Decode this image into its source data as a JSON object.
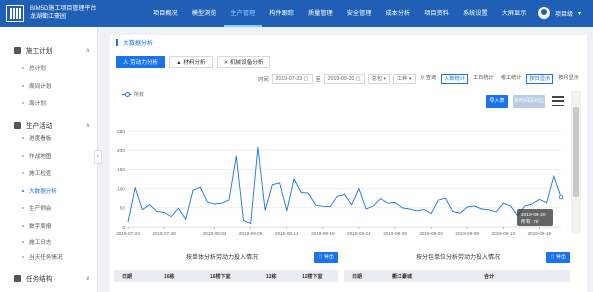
{
  "app": {
    "title_line1": "BIM5D施工项目管理平台",
    "title_line2": "龙湖衢江豪园"
  },
  "nav": {
    "items": [
      "项目概况",
      "模型浏览",
      "生产管理",
      "构件跟踪",
      "质量管理",
      "安全管理",
      "成本分析",
      "项目资料",
      "系统设置",
      "大屏显示"
    ],
    "active_index": 2
  },
  "user": {
    "name": "项目级"
  },
  "sidebar": {
    "groups": [
      {
        "label": "施工计划",
        "chev": "∧",
        "items": [
          "总计划",
          "周间计划",
          "周计划"
        ]
      },
      {
        "label": "生产活动",
        "chev": "∧",
        "items": [
          "进度看板",
          "作战地图",
          "施工检查",
          "大数据分析",
          "生产例会",
          "数字周报",
          "施工日志",
          "当天任务情况"
        ]
      },
      {
        "label": "任务结构",
        "chev": "∨",
        "items": []
      }
    ],
    "active_item": "大数据分析",
    "collapse_icon": "‹"
  },
  "breadcrumb": {
    "label": "大数据分析"
  },
  "tabs": [
    {
      "icon": "人",
      "label": "劳动力分析"
    },
    {
      "icon": "▲",
      "label": "材料分析"
    },
    {
      "icon": "✕",
      "label": "机械设备分析"
    }
  ],
  "filters": {
    "time_label": "时间",
    "date_from": "2019-07-23",
    "to_label": "至",
    "date_to": "2019-09-20",
    "select1": "总包",
    "select2": "工种",
    "query_label": "查询",
    "dim_buttons": [
      "人数统计",
      "工日统计",
      "考工统计"
    ],
    "period_buttons": [
      "按日显示",
      "按月显示"
    ]
  },
  "toolbar": {
    "import_label": "导入表",
    "compare_label": "多时间段对比"
  },
  "tooltip": {
    "date": "2019-09-20",
    "value_label": "所有: 78"
  },
  "bottom": {
    "left": {
      "title": "按单体分析劳动力投入情况",
      "button": "导出",
      "columns": [
        "日期",
        "16栋",
        "16楼下室",
        "12栋",
        "12楼下室"
      ]
    },
    "right": {
      "title": "按分包单位分析劳动力投入情况",
      "button": "导出",
      "columns": [
        "日期",
        "衢江豪城",
        "合计"
      ]
    }
  },
  "chart_data": {
    "type": "line",
    "series": [
      {
        "name": "所有",
        "color": "#1a73e8",
        "values": [
          13,
          102,
          45,
          58,
          40,
          38,
          27,
          49,
          20,
          95,
          104,
          65,
          60,
          62,
          70,
          185,
          17,
          9,
          208,
          43,
          110,
          115,
          42,
          125,
          90,
          88,
          57,
          54,
          53,
          80,
          85,
          58,
          100,
          47,
          55,
          74,
          62,
          64,
          50,
          47,
          42,
          46,
          35,
          70,
          75,
          40,
          36,
          52,
          55,
          47,
          45,
          39,
          62,
          55,
          29,
          55,
          60,
          72,
          63,
          132,
          78
        ]
      }
    ],
    "x": [
      "2019-07-23",
      "2019-07-24",
      "2019-07-25",
      "2019-07-26",
      "2019-07-27",
      "2019-07-28",
      "2019-07-29",
      "2019-07-30",
      "2019-07-31",
      "2019-08-01",
      "2019-08-02",
      "2019-08-03",
      "2019-08-04",
      "2019-08-05",
      "2019-08-06",
      "2019-08-07",
      "2019-08-08",
      "2019-08-09",
      "2019-08-10",
      "2019-08-11",
      "2019-08-12",
      "2019-08-13",
      "2019-08-14",
      "2019-08-15",
      "2019-08-16",
      "2019-08-17",
      "2019-08-18",
      "2019-08-19",
      "2019-08-20",
      "2019-08-21",
      "2019-08-22",
      "2019-08-23",
      "2019-08-24",
      "2019-08-25",
      "2019-08-26",
      "2019-08-27",
      "2019-08-28",
      "2019-08-29",
      "2019-08-30",
      "2019-08-31",
      "2019-09-01",
      "2019-09-02",
      "2019-09-03",
      "2019-09-04",
      "2019-09-05",
      "2019-09-06",
      "2019-09-07",
      "2019-09-08",
      "2019-09-09",
      "2019-09-10",
      "2019-09-11",
      "2019-09-12",
      "2019-09-13",
      "2019-09-14",
      "2019-09-15",
      "2019-09-16",
      "2019-09-17",
      "2019-09-18",
      "2019-09-19",
      "2019-09-20"
    ],
    "tick_labels": [
      "2019-07-23",
      "2019-07-28",
      "2019-08-04",
      "2019-08-09",
      "2019-08-14",
      "2019-08-19",
      "2019-08-24",
      "2019-08-29",
      "2019-09-03",
      "2019-09-08",
      "2019-09-13",
      "2019-09-18"
    ],
    "yticks": [
      0,
      50,
      100,
      150,
      200,
      250
    ],
    "ylim": [
      0,
      250
    ],
    "grid": true
  }
}
